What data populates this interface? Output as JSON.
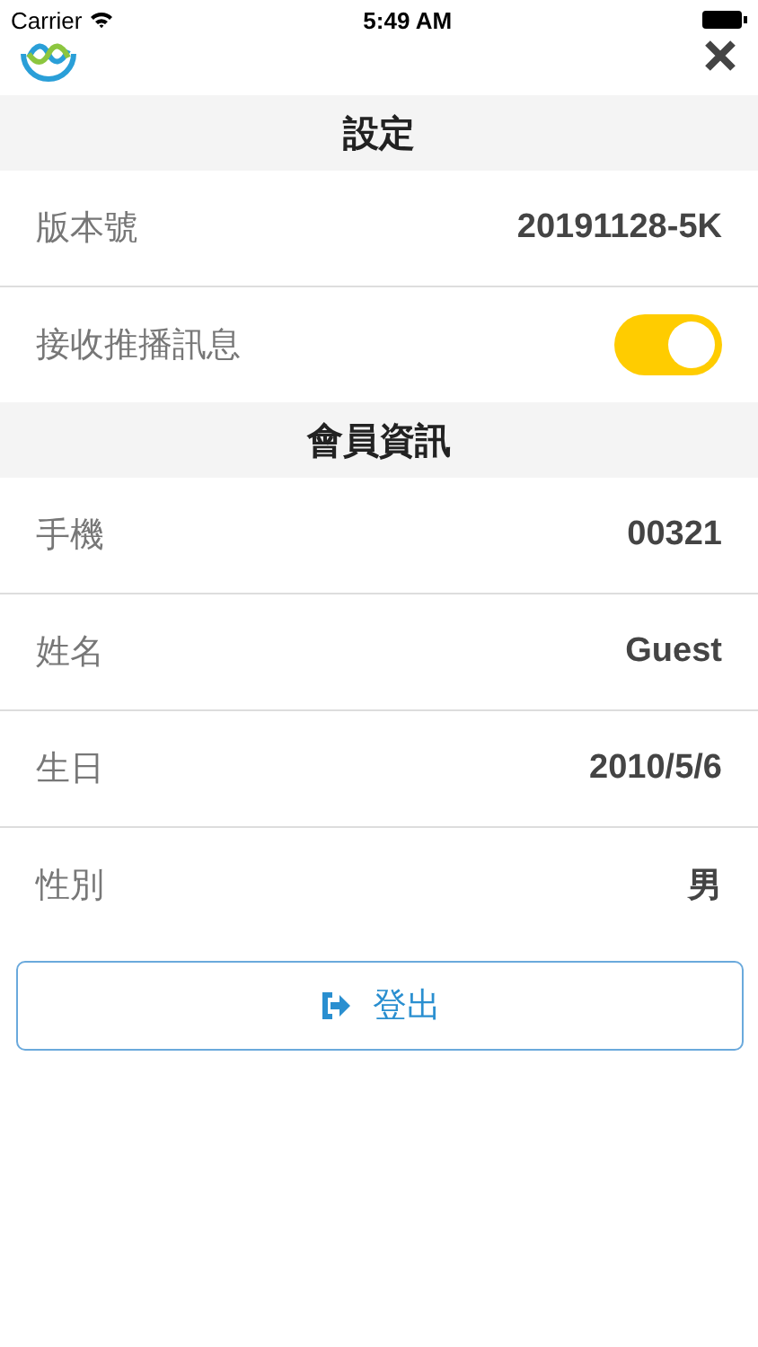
{
  "status_bar": {
    "carrier": "Carrier",
    "time": "5:49 AM"
  },
  "sections": [
    {
      "title": "設定",
      "rows": [
        {
          "kind": "value",
          "label": "版本號",
          "value": "20191128-5K"
        },
        {
          "kind": "toggle",
          "label": "接收推播訊息",
          "on": true
        }
      ]
    },
    {
      "title": "會員資訊",
      "rows": [
        {
          "kind": "value",
          "label": "手機",
          "value": "00321"
        },
        {
          "kind": "value",
          "label": "姓名",
          "value": "Guest"
        },
        {
          "kind": "value",
          "label": "生日",
          "value": "2010/5/6"
        },
        {
          "kind": "value",
          "label": "性別",
          "value": "男"
        }
      ]
    }
  ],
  "logout_button": "登出"
}
